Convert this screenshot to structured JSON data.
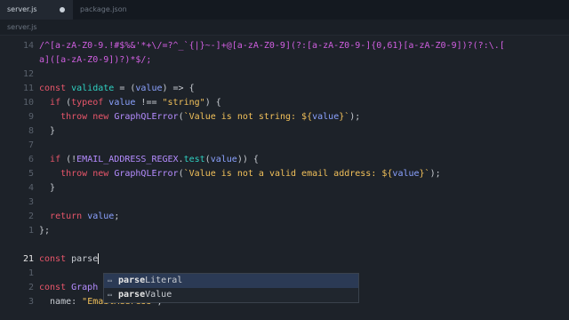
{
  "tabs": [
    {
      "label": "server.js"
    },
    {
      "label": "package.json"
    }
  ],
  "breadcrumb": "server.js",
  "lines": [
    {
      "num": "14",
      "segments": [
        {
          "c": "r",
          "t": "/^[a-zA-Z0-9.!#$%&'*+\\/=?^_`{|}~-]+@[a-zA-Z0-9](?:[a-zA-Z0-9-]{0,61}[a-zA-Z0-9])?(?:\\.["
        }
      ]
    },
    {
      "num": "",
      "segments": [
        {
          "c": "r",
          "t": "a]([a-zA-Z0-9])?)*$/;"
        }
      ]
    },
    {
      "num": "12",
      "segments": []
    },
    {
      "num": "11",
      "segments": [
        {
          "c": "k",
          "t": "const "
        },
        {
          "c": "f",
          "t": "validate"
        },
        {
          "c": "p",
          "t": " = ("
        },
        {
          "c": "i",
          "t": "value"
        },
        {
          "c": "p",
          "t": ") => {"
        }
      ]
    },
    {
      "num": "10",
      "segments": [
        {
          "c": "p",
          "t": "  "
        },
        {
          "c": "k",
          "t": "if"
        },
        {
          "c": "p",
          "t": " ("
        },
        {
          "c": "k",
          "t": "typeof"
        },
        {
          "c": "p",
          "t": " "
        },
        {
          "c": "i",
          "t": "value"
        },
        {
          "c": "p",
          "t": " !== "
        },
        {
          "c": "s",
          "t": "\"string\""
        },
        {
          "c": "p",
          "t": ") {"
        }
      ]
    },
    {
      "num": "9",
      "segments": [
        {
          "c": "p",
          "t": "    "
        },
        {
          "c": "k",
          "t": "throw"
        },
        {
          "c": "p",
          "t": " "
        },
        {
          "c": "k",
          "t": "new"
        },
        {
          "c": "p",
          "t": " "
        },
        {
          "c": "t",
          "t": "GraphQLError"
        },
        {
          "c": "p",
          "t": "("
        },
        {
          "c": "s",
          "t": "`Value is not string: ${"
        },
        {
          "c": "i",
          "t": "value"
        },
        {
          "c": "s",
          "t": "}`"
        },
        {
          "c": "p",
          "t": ");"
        }
      ]
    },
    {
      "num": "8",
      "segments": [
        {
          "c": "p",
          "t": "  }"
        }
      ]
    },
    {
      "num": "7",
      "segments": []
    },
    {
      "num": "6",
      "segments": [
        {
          "c": "p",
          "t": "  "
        },
        {
          "c": "k",
          "t": "if"
        },
        {
          "c": "p",
          "t": " (!"
        },
        {
          "c": "t",
          "t": "EMAIL_ADDRESS_REGEX"
        },
        {
          "c": "p",
          "t": "."
        },
        {
          "c": "f",
          "t": "test"
        },
        {
          "c": "p",
          "t": "("
        },
        {
          "c": "i",
          "t": "value"
        },
        {
          "c": "p",
          "t": ")) {"
        }
      ]
    },
    {
      "num": "5",
      "segments": [
        {
          "c": "p",
          "t": "    "
        },
        {
          "c": "k",
          "t": "throw"
        },
        {
          "c": "p",
          "t": " "
        },
        {
          "c": "k",
          "t": "new"
        },
        {
          "c": "p",
          "t": " "
        },
        {
          "c": "t",
          "t": "GraphQLError"
        },
        {
          "c": "p",
          "t": "("
        },
        {
          "c": "s",
          "t": "`Value is not a valid email address: ${"
        },
        {
          "c": "i",
          "t": "value"
        },
        {
          "c": "s",
          "t": "}`"
        },
        {
          "c": "p",
          "t": ");"
        }
      ]
    },
    {
      "num": "4",
      "segments": [
        {
          "c": "p",
          "t": "  }"
        }
      ]
    },
    {
      "num": "3",
      "segments": []
    },
    {
      "num": "2",
      "segments": [
        {
          "c": "p",
          "t": "  "
        },
        {
          "c": "k",
          "t": "return"
        },
        {
          "c": "p",
          "t": " "
        },
        {
          "c": "i",
          "t": "value"
        },
        {
          "c": "p",
          "t": ";"
        }
      ]
    },
    {
      "num": "1",
      "segments": [
        {
          "c": "p",
          "t": "};"
        }
      ]
    },
    {
      "num": "",
      "segments": []
    },
    {
      "num": "21",
      "current": true,
      "segments": [
        {
          "c": "k",
          "t": "const "
        },
        {
          "c": "p",
          "t": "parse"
        }
      ]
    },
    {
      "num": "1",
      "segments": []
    },
    {
      "num": "2",
      "segments": [
        {
          "c": "k",
          "t": "const "
        },
        {
          "c": "t",
          "t": "Graph"
        }
      ]
    },
    {
      "num": "3",
      "segments": [
        {
          "c": "p",
          "t": "  name: "
        },
        {
          "c": "s",
          "t": "\"EmailAddress\""
        },
        {
          "c": "p",
          "t": ","
        }
      ]
    }
  ],
  "autocomplete": [
    {
      "match": "parse",
      "rest": "Literal",
      "icon": "▭",
      "selected": true
    },
    {
      "match": "parse",
      "rest": "Value",
      "icon": "▭",
      "selected": false
    }
  ],
  "colors": {
    "background": "#1d2229",
    "keyword": "#e8566a",
    "function": "#2fd1c2",
    "string": "#f1c05a",
    "regex": "#d05fe0",
    "identifier": "#8ba2ff"
  }
}
